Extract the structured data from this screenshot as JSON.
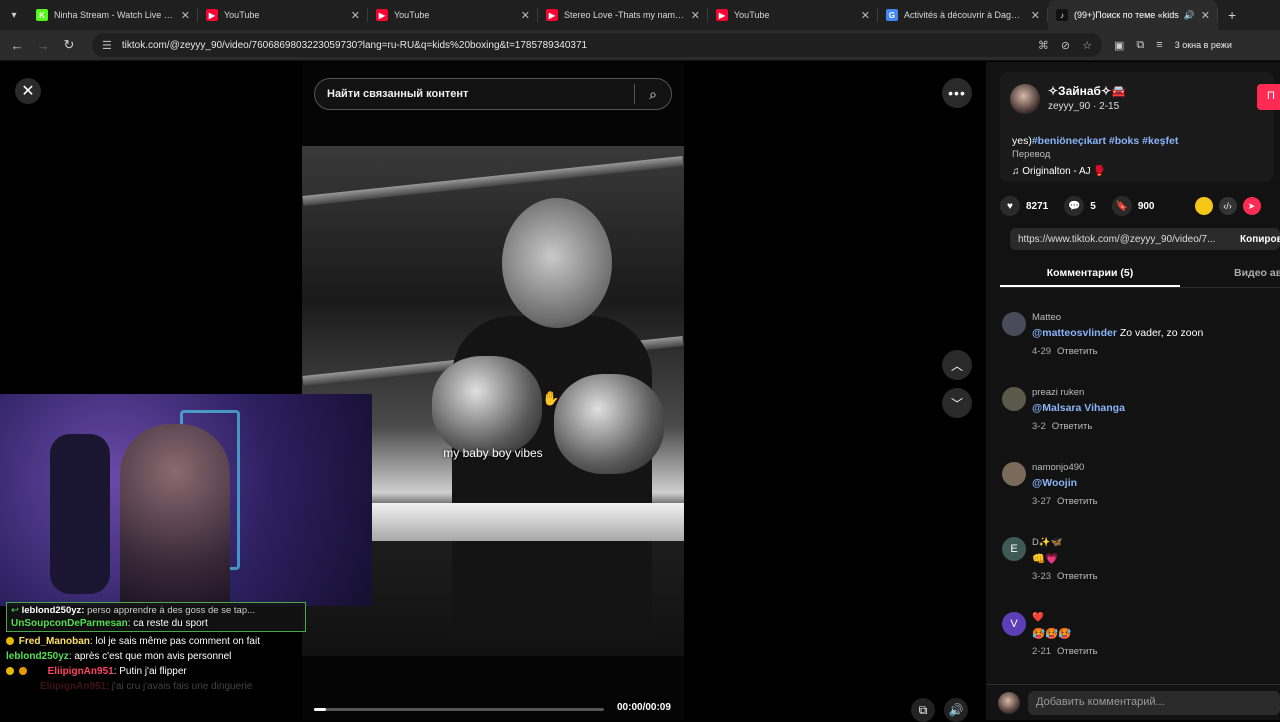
{
  "browser": {
    "tabs": [
      {
        "title": "Ninha Stream - Watch Live on K",
        "color": "#53fc18",
        "glyph": "K"
      },
      {
        "title": "YouTube",
        "color": "#ff0033",
        "glyph": "▶"
      },
      {
        "title": "YouTube",
        "color": "#ff0033",
        "glyph": "▶"
      },
      {
        "title": "Stereo Love -Thats my name Re",
        "color": "#ff0033",
        "glyph": "▶"
      },
      {
        "title": "YouTube",
        "color": "#ff0033",
        "glyph": "▶"
      },
      {
        "title": "Activités à découvrir à Daghest",
        "color": "#4285f4",
        "glyph": "G"
      },
      {
        "title": "(99+)Поиск по теме «kids",
        "color": "#111111",
        "glyph": "♪"
      }
    ],
    "url": "tiktok.com/@zeyyy_90/video/7606869803223059730?lang=ru-RU&q=kids%20boxing&t=1785789340371",
    "windows_label": "3 окна в режи"
  },
  "player": {
    "search_placeholder": "Найти связанный контент",
    "caption": "my baby boy vibes",
    "time": "00:00/00:09",
    "progress_percent": 4
  },
  "chat": {
    "reply_user": "leblond250yz:",
    "reply_text": "perso apprendre à des goss de se tap...",
    "messages": [
      {
        "user": "UnSoupconDeParmesan",
        "text": "ca reste du sport",
        "color": "#55e055"
      },
      {
        "user": "Fred_Manoban",
        "text": "lol je sais même pas comment on fait",
        "color": "#ffe066"
      },
      {
        "user": "leblond250yz",
        "text": "après c'est que mon avis personnel",
        "color": "#55e055"
      },
      {
        "user": "EliipignAn951",
        "text": "Putin j'ai flipper",
        "color": "#ff4466"
      },
      {
        "user": "EliipignAn951",
        "text": "j'ai cru j'avais fais une dinguerie",
        "color": "#ff4466"
      }
    ]
  },
  "panel": {
    "display_name": "✧Зайнаб✧🚘",
    "handle": "zeyyy_90 · 2-15",
    "follow_label": "П",
    "desc_prefix": "yes)",
    "tags": "#beniöneçıkart #boks #keşfet",
    "translate_label": "Перевод",
    "music": "♫  Originalton - AJ 🥊",
    "likes": "8271",
    "comments_count": "5",
    "saves": "900",
    "link": "https://www.tiktok.com/@zeyyy_90/video/7...",
    "copy_label": "Копиров",
    "tab_comments": "Комментарии (5)",
    "tab_videos": "Видео ав",
    "add_comment_placeholder": "Добавить комментарий...",
    "comments": [
      {
        "user": "Matteo",
        "mention": "@matteosvlinder",
        "text": " Zo vader, zo zoon",
        "date": "4-29",
        "reply": "Ответить",
        "avatar": "",
        "avcolor": "#4a4a5a"
      },
      {
        "user": "preazi ruken",
        "mention": "@Malsara Vihanga",
        "text": "",
        "date": "3-2",
        "reply": "Ответить",
        "avatar": "",
        "avcolor": "#5a5a4a"
      },
      {
        "user": "namonjo490",
        "mention": "@Woojin",
        "text": "",
        "date": "3-27",
        "reply": "Ответить",
        "avatar": "",
        "avcolor": "#7a6a5a"
      },
      {
        "user": "D✨🦋",
        "mention": "",
        "text": "👊💗",
        "date": "3-23",
        "reply": "Ответить",
        "avatar": "E",
        "avcolor": "#3e5a52"
      },
      {
        "user": "❤️",
        "mention": "",
        "text": "🥵🥵🥵",
        "date": "2-21",
        "reply": "Ответить",
        "avatar": "V",
        "avcolor": "#5b3fb8"
      }
    ]
  }
}
